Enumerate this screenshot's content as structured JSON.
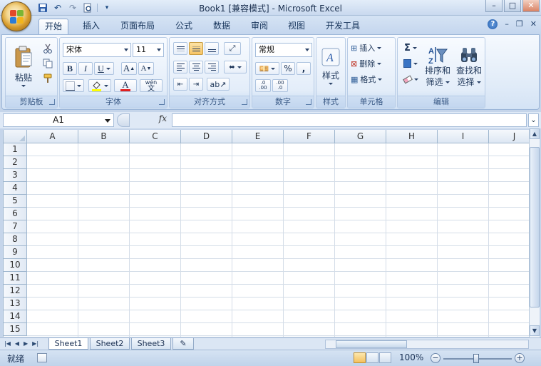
{
  "app": {
    "title": "Book1  [兼容模式] - Microsoft Excel"
  },
  "tabs": [
    {
      "label": "开始",
      "active": true
    },
    {
      "label": "插入"
    },
    {
      "label": "页面布局"
    },
    {
      "label": "公式"
    },
    {
      "label": "数据"
    },
    {
      "label": "审阅"
    },
    {
      "label": "视图"
    },
    {
      "label": "开发工具"
    }
  ],
  "ribbon": {
    "clipboard": {
      "group_label": "剪贴板",
      "paste_label": "粘贴"
    },
    "font": {
      "group_label": "字体",
      "font_name": "宋体",
      "font_size": "11",
      "bold": "B",
      "italic": "I",
      "underline": "U",
      "grow": "A",
      "shrink": "A",
      "font_color_letter": "A",
      "phonetic": "wén"
    },
    "alignment": {
      "group_label": "对齐方式"
    },
    "number": {
      "group_label": "数字",
      "format": "常规",
      "percent": "%",
      "comma": ",",
      "inc_decimal": ".0 .00",
      "dec_decimal": ".00 .0"
    },
    "styles": {
      "group_label": "样式",
      "styles_label": "样式"
    },
    "cells": {
      "group_label": "单元格",
      "insert": "插入",
      "delete": "删除",
      "format": "格式"
    },
    "editing": {
      "group_label": "编辑",
      "sort_filter_1": "排序和",
      "sort_filter_2": "筛选",
      "find_select_1": "查找和",
      "find_select_2": "选择",
      "sigma": "Σ"
    }
  },
  "formula_bar": {
    "name_box": "A1",
    "fx": "fx",
    "formula": ""
  },
  "grid": {
    "columns": [
      "A",
      "B",
      "C",
      "D",
      "E",
      "F",
      "G",
      "H",
      "I",
      "J"
    ],
    "rows": [
      "1",
      "2",
      "3",
      "4",
      "5",
      "6",
      "7",
      "8",
      "9",
      "10",
      "11",
      "12",
      "13",
      "14",
      "15"
    ]
  },
  "sheets": [
    {
      "label": "Sheet1",
      "active": true
    },
    {
      "label": "Sheet2"
    },
    {
      "label": "Sheet3"
    }
  ],
  "status": {
    "ready": "就绪",
    "zoom": "100%"
  },
  "colors": {
    "accent": "#1f5aaa",
    "font_color": "#e02020",
    "highlight": "#ffff00"
  }
}
